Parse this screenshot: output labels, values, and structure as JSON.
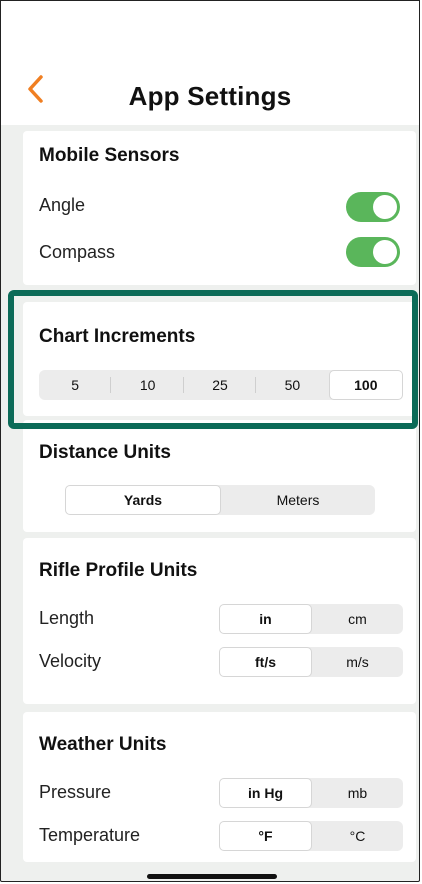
{
  "header": {
    "title": "App Settings",
    "back_icon": "chevron-left-icon",
    "accent": "#f07f22"
  },
  "mobile_sensors": {
    "title": "Mobile Sensors",
    "angle": {
      "label": "Angle",
      "on": true
    },
    "compass": {
      "label": "Compass",
      "on": true
    }
  },
  "chart_increments": {
    "title": "Chart Increments",
    "options": [
      "5",
      "10",
      "25",
      "50",
      "100"
    ],
    "selected": "100"
  },
  "distance_units": {
    "title": "Distance Units",
    "options": [
      "Yards",
      "Meters"
    ],
    "selected": "Yards"
  },
  "rifle_profile_units": {
    "title": "Rifle Profile Units",
    "length": {
      "label": "Length",
      "options": [
        "in",
        "cm"
      ],
      "selected": "in"
    },
    "velocity": {
      "label": "Velocity",
      "options": [
        "ft/s",
        "m/s"
      ],
      "selected": "ft/s"
    }
  },
  "weather_units": {
    "title": "Weather Units",
    "pressure": {
      "label": "Pressure",
      "options": [
        "in Hg",
        "mb"
      ],
      "selected": "in Hg"
    },
    "temperature": {
      "label": "Temperature",
      "options": [
        "°F",
        "°C"
      ],
      "selected": "°F"
    }
  },
  "colors": {
    "toggle_on": "#5ab65b",
    "highlight": "#0c6b58"
  }
}
